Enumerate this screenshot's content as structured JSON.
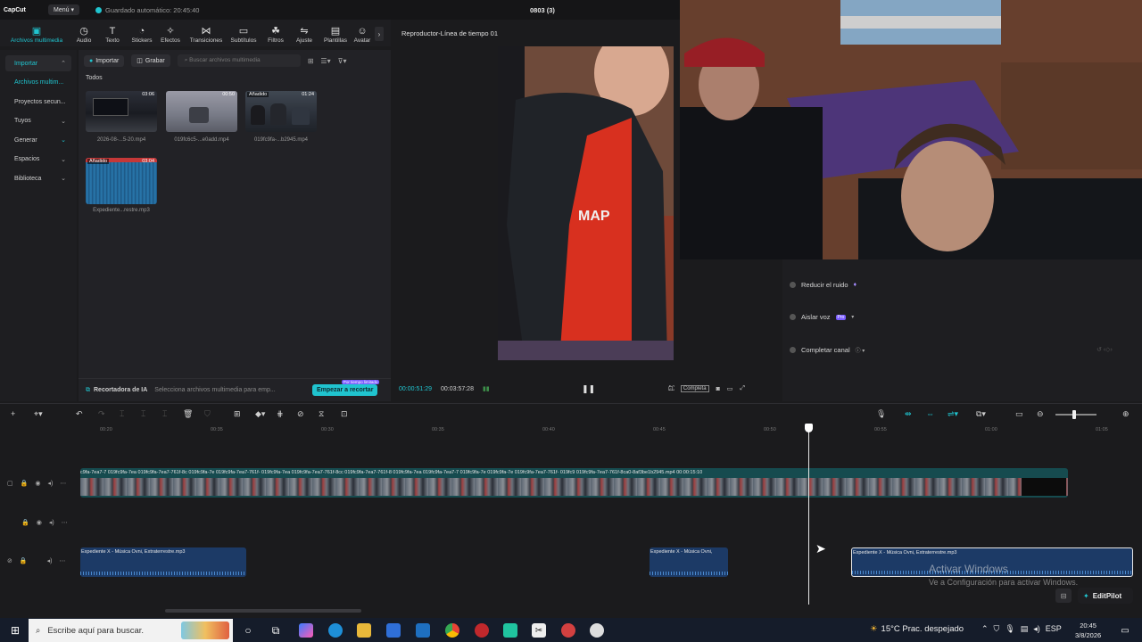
{
  "titlebar": {
    "app_name": "CapCut",
    "menu_label": "Menú",
    "autosave": "Guardado automático: 20:45:40",
    "project_name": "0803 (3)"
  },
  "toolbar": {
    "tools": [
      {
        "label": "Archivos multimedia",
        "icon": "media-icon"
      },
      {
        "label": "Audio",
        "icon": "audio-icon"
      },
      {
        "label": "Texto",
        "icon": "text-icon"
      },
      {
        "label": "Stickers",
        "icon": "sticker-icon"
      },
      {
        "label": "Efectos",
        "icon": "effects-icon"
      },
      {
        "label": "Transiciones",
        "icon": "transition-icon"
      },
      {
        "label": "Subtítulos",
        "icon": "subtitle-icon"
      },
      {
        "label": "Filtros",
        "icon": "filter-icon"
      },
      {
        "label": "Ajuste",
        "icon": "adjust-icon"
      },
      {
        "label": "Plantillas",
        "icon": "template-icon"
      },
      {
        "label": "Avatar",
        "icon": "avatar-icon"
      }
    ]
  },
  "leftnav": {
    "items": [
      {
        "label": "Importar",
        "selected": true
      },
      {
        "label": "Archivos multim...",
        "selected": false
      },
      {
        "label": "Proyectos secun...",
        "selected": false
      },
      {
        "label": "Tuyos",
        "selected": false
      },
      {
        "label": "Generar",
        "selected": false
      },
      {
        "label": "Espacios",
        "selected": false
      },
      {
        "label": "Biblioteca",
        "selected": false
      }
    ]
  },
  "media": {
    "import_label": "Importar",
    "record_label": "Grabar",
    "search_placeholder": "Buscar archivos multimedia",
    "filter_label": "Todos",
    "clips": [
      {
        "name": "2026-08-...5-20.mp4",
        "duration": "03:06",
        "badge": ""
      },
      {
        "name": "019fc6c5-...e0add.mp4",
        "duration": "00:50",
        "badge": ""
      },
      {
        "name": "019fc9fa-...b2945.mp4",
        "duration": "01:24",
        "badge": "Añadido"
      },
      {
        "name": "Expediente...restre.mp3",
        "duration": "03:04",
        "badge": "Añadido"
      }
    ],
    "ai_title": "Recortadora de IA",
    "ai_desc": "Selecciona archivos multimedia para emp...",
    "ai_button": "Empezar a recortar",
    "ai_tag": "Por tiempo limitado"
  },
  "player": {
    "title": "Reproductor-Línea de tiempo 01",
    "current_time": "00:00:51:29",
    "total_time": "00:03:57:28",
    "ratio_label": "Completa"
  },
  "audio_panel": {
    "options": [
      {
        "label": "Reducir el ruido",
        "tag": ""
      },
      {
        "label": "Aislar voz",
        "tag": "Pro"
      },
      {
        "label": "Completar canal",
        "tag": ""
      }
    ]
  },
  "timeline": {
    "ruler": [
      "00:20",
      "00:35",
      "00:30",
      "00:35",
      "00:40",
      "00:45",
      "00:50",
      "00:55",
      "01:00",
      "01:05"
    ],
    "video_label": "c9fa-7ea7-7  019fc9fa-7ea  019fc9fa-7ea7-761f-8c  019fc9fa-7e  019fc9fa-7ea7-761f-  019fc9fa-7ea  019fc9fa-7ea7-761f-8cc  019fc9fa-7ea7-761f-8  019fc9fa-7ea  019fc9fa-7ea7-7  019fc9fa-7e  019fc9fa-7e  019fc9fa-7ea7-761f-  019fc9  019fc9fa-7ea7-761f-8ca0-8af3be1b2945.mp4  00:00:15:10",
    "audio_clips": [
      {
        "label": "Expediente X - Música Ovni, Extraterrestre.mp3"
      },
      {
        "label": "Expediente X - Música Ovni,"
      },
      {
        "label": "Expediente X - Música Ovni, Extraterrestre.mp3"
      }
    ]
  },
  "watermark": {
    "title": "Activar Windows",
    "subtitle": "Ve a Configuración para activar Windows."
  },
  "editpilot_label": "EditPilot",
  "taskbar": {
    "search_placeholder": "Escribe aquí para buscar.",
    "weather": "15°C  Prac. despejado",
    "lang": "ESP",
    "time": "20:45",
    "date": "3/8/2026"
  },
  "colors": {
    "accent": "#20c4cf",
    "video_track": "#164b4f",
    "audio_track": "#1c3a66"
  }
}
